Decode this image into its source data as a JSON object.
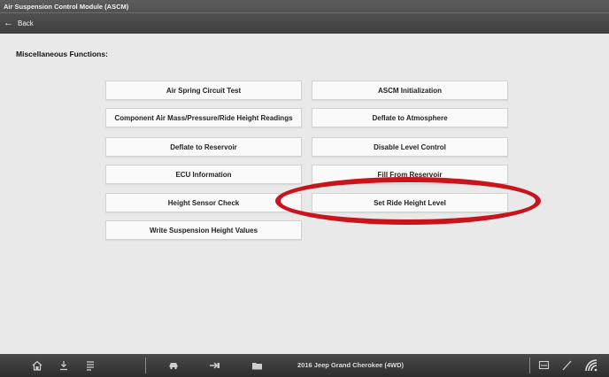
{
  "header": {
    "title": "Air Suspension Control Module (ASCM)",
    "back_label": "Back",
    "back_icon": "left-arrow-icon"
  },
  "main": {
    "section_title": "Miscellaneous Functions:",
    "functions": [
      "Air Spring Circuit Test",
      "ASCM Initialization",
      "Component Air Mass/Pressure/Ride Height Readings",
      "Deflate to Atmosphere",
      "Deflate to Reservoir",
      "Disable Level Control",
      "ECU Information",
      "Fill From Reservoir",
      "Height Sensor Check",
      "Set Ride Height Level",
      "Write Suspension Height Values"
    ],
    "highlighted_function": "Set Ride Height Level",
    "highlight_color": "#c8141c"
  },
  "footer": {
    "vehicle": "2016 Jeep Grand Cherokee (4WD)",
    "icons": [
      "home-icon",
      "download-icon",
      "list-icon",
      "car-icon",
      "send-icon",
      "folder-icon",
      "screen-icon",
      "tools-icon",
      "wifi-signal-icon"
    ]
  }
}
